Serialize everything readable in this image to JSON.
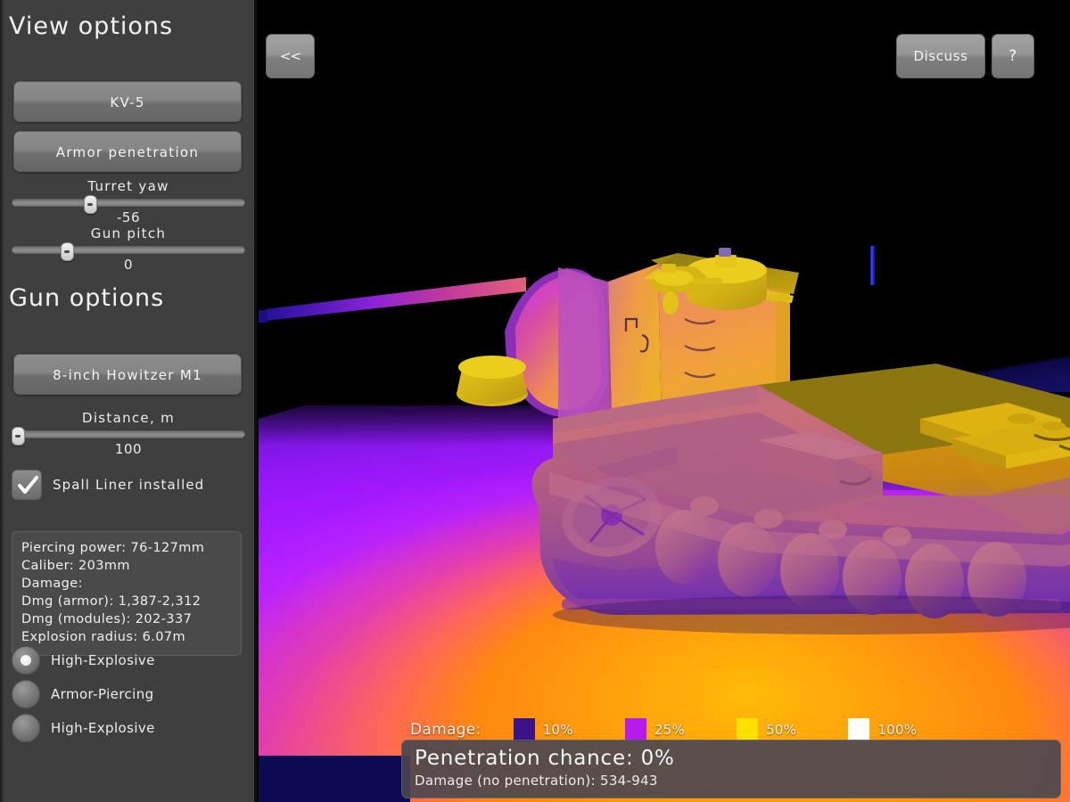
{
  "sidebar": {
    "view_options_title": "View options",
    "tank_button": "KV-5",
    "mode_button": "Armor penetration",
    "turret_yaw": {
      "label": "Turret yaw",
      "value": "-56",
      "percent": 33
    },
    "gun_pitch": {
      "label": "Gun pitch",
      "value": "0",
      "percent": 23
    },
    "gun_options_title": "Gun options",
    "gun_button": "8-inch Howitzer M1",
    "distance": {
      "label": "Distance, m",
      "value": "100",
      "percent": 2
    },
    "spall_liner": {
      "label": "Spall Liner installed",
      "checked": true
    },
    "info": [
      "Piercing power: 76-127mm",
      "Caliber: 203mm",
      "Damage:",
      "Dmg (armor): 1,387-2,312",
      "Dmg (modules): 202-337",
      "Explosion radius: 6.07m"
    ],
    "shell_types": [
      {
        "label": "High-Explosive",
        "selected": true
      },
      {
        "label": "Armor-Piercing",
        "selected": false
      },
      {
        "label": "High-Explosive",
        "selected": false
      }
    ]
  },
  "topbar": {
    "back_label": "<<",
    "discuss_label": "Discuss",
    "help_label": "?"
  },
  "legend": {
    "title": "Damage:",
    "items": [
      {
        "pct": "10%",
        "color": "#3b1287"
      },
      {
        "pct": "25%",
        "color": "#b41ced"
      },
      {
        "pct": "50%",
        "color": "#ffe000"
      },
      {
        "pct": "100%",
        "color": "#ffffff"
      }
    ]
  },
  "result": {
    "penetration_chance": "Penetration chance: 0%",
    "damage_no_penetration": "Damage (no penetration): 534-943"
  },
  "colors": {
    "sidebar_bg": "#3f3f3f",
    "panel_bg": "#4a4a4a",
    "accent_hot": "#ffbe28",
    "accent_cold": "#0c0a52",
    "ground_purple": "#8d27e0"
  }
}
